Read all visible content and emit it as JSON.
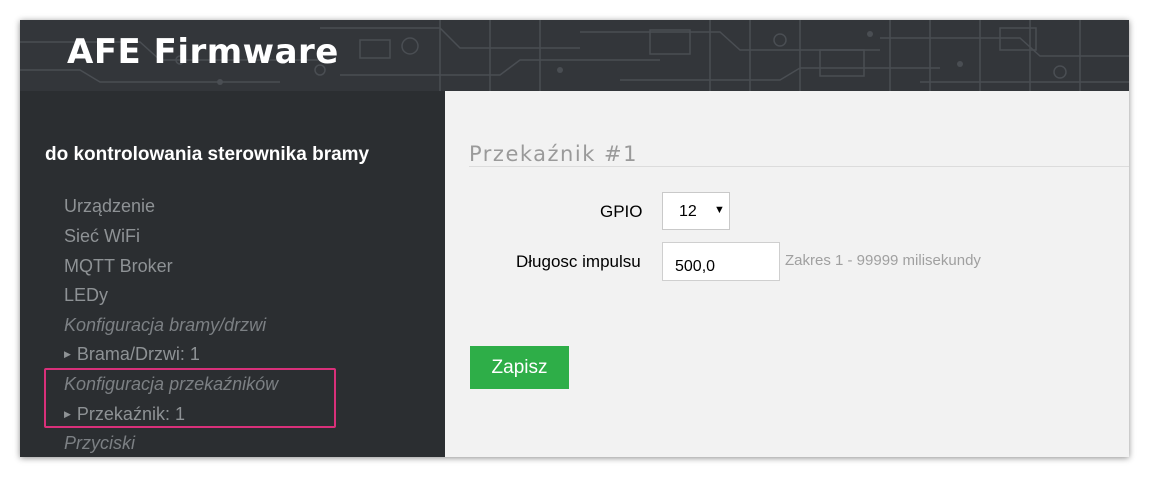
{
  "app": {
    "title": "AFE Firmware"
  },
  "colors": {
    "header_bg": "#33363a",
    "sidebar_bg": "#2b2e31",
    "accent_green": "#2eae48",
    "highlight_pink": "#d9307a"
  },
  "sidebar": {
    "title": "do kontrolowania sterownika bramy",
    "items": [
      {
        "label": "Urządzenie",
        "type": "link"
      },
      {
        "label": "Sieć WiFi",
        "type": "link"
      },
      {
        "label": "MQTT Broker",
        "type": "link"
      },
      {
        "label": "LEDy",
        "type": "link"
      },
      {
        "label": "Konfiguracja bramy/drzwi",
        "type": "section"
      },
      {
        "label": "Brama/Drzwi: 1",
        "type": "sublink",
        "icon": "triangle-right-icon"
      },
      {
        "label": "Konfiguracja przekaźników",
        "type": "section"
      },
      {
        "label": "Przekaźnik: 1",
        "type": "sublink",
        "icon": "triangle-right-icon"
      },
      {
        "label": "Przyciski",
        "type": "section"
      }
    ]
  },
  "main": {
    "section_title": "Przekaźnik #1",
    "gpio": {
      "label": "GPIO",
      "value": "12"
    },
    "impulse": {
      "label": "Długosc impulsu",
      "value": "500,0",
      "hint": "Zakres 1 - 99999 milisekundy"
    },
    "save_label": "Zapisz"
  }
}
